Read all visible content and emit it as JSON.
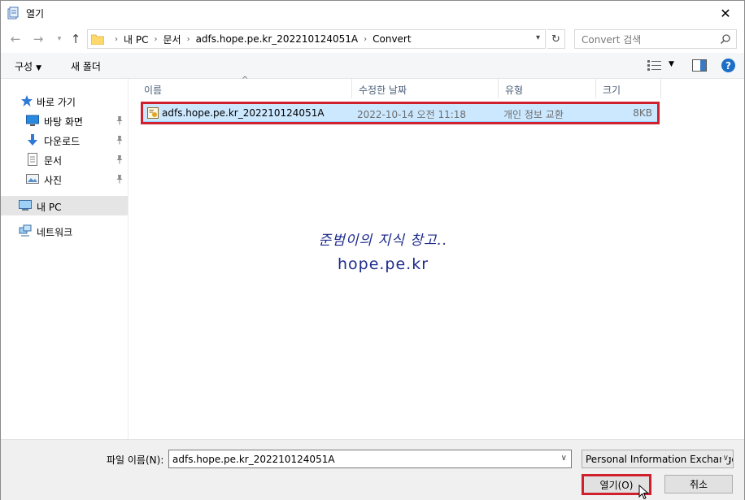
{
  "window": {
    "title": "열기",
    "close_symbol": "✕"
  },
  "nav": {
    "back_icon": "arrow-left-icon",
    "forward_icon": "arrow-right-icon",
    "up_icon": "arrow-up-icon",
    "breadcrumbs": [
      "내 PC",
      "문서",
      "adfs.hope.pe.kr_202210124051A",
      "Convert"
    ],
    "search_placeholder": "Convert 검색"
  },
  "toolbar": {
    "organize_label": "구성",
    "new_folder_label": "새 폴더"
  },
  "sidebar": {
    "items": [
      {
        "label": "바로 가기",
        "icon": "star-icon"
      },
      {
        "label": "바탕 화면",
        "icon": "desktop-icon",
        "pinned": true
      },
      {
        "label": "다운로드",
        "icon": "download-icon",
        "pinned": true
      },
      {
        "label": "문서",
        "icon": "document-icon",
        "pinned": true
      },
      {
        "label": "사진",
        "icon": "picture-icon",
        "pinned": true
      },
      {
        "label": "내 PC",
        "icon": "computer-icon",
        "selected": true
      },
      {
        "label": "네트워크",
        "icon": "network-icon"
      }
    ]
  },
  "filelist": {
    "columns": [
      "이름",
      "수정한 날짜",
      "유형",
      "크기"
    ],
    "files": [
      {
        "name": "adfs.hope.pe.kr_202210124051A",
        "date": "2022-10-14 오전 11:18",
        "type": "개인 정보 교환",
        "size": "8KB",
        "selected": true
      }
    ]
  },
  "watermark": {
    "line1": "준범이의 지식 창고..",
    "line2": "hope.pe.kr"
  },
  "bottom": {
    "filename_label": "파일 이름(N):",
    "filename_value": "adfs.hope.pe.kr_202210124051A",
    "filetype_value": "Personal Information Exchange",
    "open_label": "열기(O)",
    "cancel_label": "취소"
  },
  "colors": {
    "highlight_red": "#d0202e",
    "selection_blue": "#cce8ff",
    "help_blue": "#1c6ec6"
  }
}
